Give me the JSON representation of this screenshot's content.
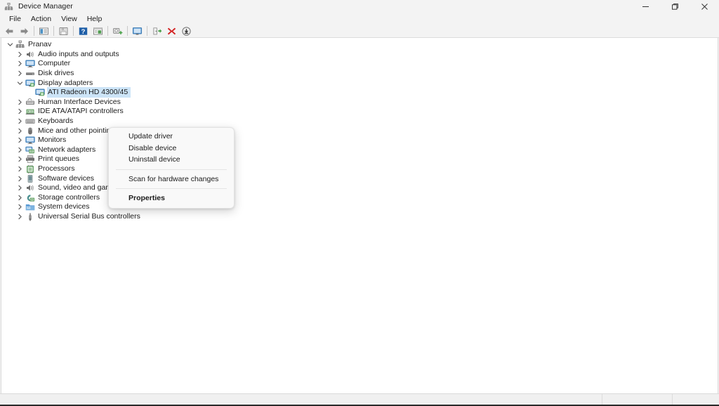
{
  "window": {
    "title": "Device Manager",
    "icon": "device-manager-icon",
    "controls": {
      "minimize": "minimize-icon",
      "maximize": "maximize-icon",
      "close": "close-icon"
    }
  },
  "menubar": {
    "items": [
      {
        "label": "File"
      },
      {
        "label": "Action"
      },
      {
        "label": "View"
      },
      {
        "label": "Help"
      }
    ]
  },
  "toolbar": {
    "buttons": [
      {
        "name": "back-button",
        "icon": "back-arrow-icon"
      },
      {
        "name": "forward-button",
        "icon": "forward-arrow-icon"
      },
      {
        "name": "show-hide-console-tree-button",
        "icon": "console-tree-icon"
      },
      {
        "name": "save-button",
        "icon": "save-disk-icon"
      },
      {
        "name": "help-button",
        "icon": "help-question-icon"
      },
      {
        "name": "properties-button",
        "icon": "properties-window-icon"
      },
      {
        "name": "scan-for-hardware-changes-button",
        "icon": "scan-hardware-icon"
      },
      {
        "name": "display-button",
        "icon": "monitor-icon"
      },
      {
        "name": "update-driver-button",
        "icon": "update-driver-icon"
      },
      {
        "name": "uninstall-device-button",
        "icon": "red-x-uninstall-icon"
      },
      {
        "name": "add-legacy-hardware-button",
        "icon": "download-circle-icon"
      }
    ]
  },
  "tree": {
    "root": {
      "label": "Pranav",
      "icon": "computer-root-icon",
      "expanded": true
    },
    "nodes": [
      {
        "label": "Audio inputs and outputs",
        "icon": "speaker-icon",
        "depth": 1,
        "expanded": false,
        "selected": false
      },
      {
        "label": "Computer",
        "icon": "monitor-icon",
        "depth": 1,
        "expanded": false,
        "selected": false
      },
      {
        "label": "Disk drives",
        "icon": "disk-drive-icon",
        "depth": 1,
        "expanded": false,
        "selected": false
      },
      {
        "label": "Display adapters",
        "icon": "display-adapter-icon",
        "depth": 1,
        "expanded": true,
        "selected": false
      },
      {
        "label": "ATI Radeon HD 4300/45",
        "icon": "display-adapter-icon",
        "depth": 2,
        "expanded": null,
        "selected": true
      },
      {
        "label": "Human Interface Devices",
        "icon": "hid-icon",
        "depth": 1,
        "expanded": false,
        "selected": false
      },
      {
        "label": "IDE ATA/ATAPI controllers",
        "icon": "ide-controller-icon",
        "depth": 1,
        "expanded": false,
        "selected": false
      },
      {
        "label": "Keyboards",
        "icon": "keyboard-icon",
        "depth": 1,
        "expanded": false,
        "selected": false
      },
      {
        "label": "Mice and other pointing d",
        "icon": "mouse-icon",
        "depth": 1,
        "expanded": false,
        "selected": false
      },
      {
        "label": "Monitors",
        "icon": "monitor-icon",
        "depth": 1,
        "expanded": false,
        "selected": false
      },
      {
        "label": "Network adapters",
        "icon": "network-adapter-icon",
        "depth": 1,
        "expanded": false,
        "selected": false
      },
      {
        "label": "Print queues",
        "icon": "printer-icon",
        "depth": 1,
        "expanded": false,
        "selected": false
      },
      {
        "label": "Processors",
        "icon": "processor-icon",
        "depth": 1,
        "expanded": false,
        "selected": false
      },
      {
        "label": "Software devices",
        "icon": "software-device-icon",
        "depth": 1,
        "expanded": false,
        "selected": false
      },
      {
        "label": "Sound, video and game controllers",
        "icon": "speaker-icon",
        "depth": 1,
        "expanded": false,
        "selected": false
      },
      {
        "label": "Storage controllers",
        "icon": "storage-controller-icon",
        "depth": 1,
        "expanded": false,
        "selected": false
      },
      {
        "label": "System devices",
        "icon": "system-device-icon",
        "depth": 1,
        "expanded": false,
        "selected": false
      },
      {
        "label": "Universal Serial Bus controllers",
        "icon": "usb-icon",
        "depth": 1,
        "expanded": false,
        "selected": false
      }
    ]
  },
  "context_menu": {
    "items": [
      {
        "label": "Update driver",
        "bold": false
      },
      {
        "label": "Disable device",
        "bold": false
      },
      {
        "label": "Uninstall device",
        "bold": false
      },
      {
        "label": "Scan for hardware changes",
        "bold": false
      },
      {
        "label": "Properties",
        "bold": true
      }
    ]
  },
  "statusbar": {
    "main": "",
    "pane1": "",
    "pane2": ""
  },
  "colors": {
    "selection": "#cce4f7",
    "accent_blue": "#0078d4",
    "uninstall_red": "#d32020",
    "update_green": "#3a9b3a",
    "window_bg": "#f3f3f3",
    "content_bg": "#ffffff"
  }
}
